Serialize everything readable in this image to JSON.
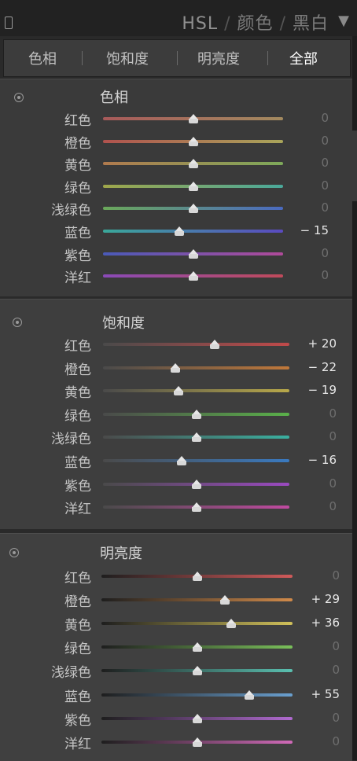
{
  "header": {
    "title_hsl": "HSL",
    "sep1": "/",
    "title_color": "颜色",
    "sep2": "/",
    "title_bw": "黑白",
    "arrow": "▼"
  },
  "tabs": [
    {
      "label": "色相"
    },
    {
      "label": "饱和度"
    },
    {
      "label": "明亮度"
    },
    {
      "label": "全部"
    }
  ],
  "active_tab": "全部",
  "sections": [
    {
      "title": "色相",
      "rows": [
        {
          "label": "红色",
          "value": "0",
          "n": 0,
          "grad": [
            "#a85a5a",
            "#a38a5f"
          ]
        },
        {
          "label": "橙色",
          "value": "0",
          "n": 0,
          "grad": [
            "#b0524e",
            "#a9a55a"
          ]
        },
        {
          "label": "黄色",
          "value": "0",
          "n": 0,
          "grad": [
            "#b07a4e",
            "#7ea95a"
          ]
        },
        {
          "label": "绿色",
          "value": "0",
          "n": 0,
          "grad": [
            "#9fa64a",
            "#4aa89a"
          ]
        },
        {
          "label": "浅绿色",
          "value": "0",
          "n": 0,
          "grad": [
            "#6aa85a",
            "#4a6ac0"
          ]
        },
        {
          "label": "蓝色",
          "value": "− 15",
          "n": -15,
          "grad": [
            "#3aa89a",
            "#5a4ac0"
          ]
        },
        {
          "label": "紫色",
          "value": "0",
          "n": 0,
          "grad": [
            "#4a5ab8",
            "#b04a9a"
          ]
        },
        {
          "label": "洋红",
          "value": "0",
          "n": 0,
          "grad": [
            "#8a4ab8",
            "#c04a5a"
          ]
        }
      ]
    },
    {
      "title": "饱和度",
      "rows": [
        {
          "label": "红色",
          "value": "+ 20",
          "n": 20,
          "grad": [
            "#4a4a4a",
            "#c04a4a"
          ]
        },
        {
          "label": "橙色",
          "value": "− 22",
          "n": -22,
          "grad": [
            "#4a4a4a",
            "#c0783a"
          ]
        },
        {
          "label": "黄色",
          "value": "− 19",
          "n": -19,
          "grad": [
            "#4a4a4a",
            "#b8a84a"
          ]
        },
        {
          "label": "绿色",
          "value": "0",
          "n": 0,
          "grad": [
            "#4a4a4a",
            "#5ab04a"
          ]
        },
        {
          "label": "浅绿色",
          "value": "0",
          "n": 0,
          "grad": [
            "#4a4a4a",
            "#3ab0a0"
          ]
        },
        {
          "label": "蓝色",
          "value": "− 16",
          "n": -16,
          "grad": [
            "#4a4a4a",
            "#3a7ac0"
          ]
        },
        {
          "label": "紫色",
          "value": "0",
          "n": 0,
          "grad": [
            "#4a4a4a",
            "#9a4ac0"
          ]
        },
        {
          "label": "洋红",
          "value": "0",
          "n": 0,
          "grad": [
            "#4a4a4a",
            "#c04aa0"
          ]
        }
      ]
    },
    {
      "title": "明亮度",
      "rows": [
        {
          "label": "红色",
          "value": "0",
          "n": 0,
          "grad": [
            "#1e1e1e",
            "#d05a5a"
          ]
        },
        {
          "label": "橙色",
          "value": "+ 29",
          "n": 29,
          "grad": [
            "#1e1e1e",
            "#d08a4a"
          ]
        },
        {
          "label": "黄色",
          "value": "+ 36",
          "n": 36,
          "grad": [
            "#1e1e1e",
            "#d0c05a"
          ]
        },
        {
          "label": "绿色",
          "value": "0",
          "n": 0,
          "grad": [
            "#1e1e1e",
            "#7ac05a"
          ]
        },
        {
          "label": "浅绿色",
          "value": "0",
          "n": 0,
          "grad": [
            "#1e1e1e",
            "#5ac0b0"
          ]
        },
        {
          "label": "蓝色",
          "value": "+ 55",
          "n": 55,
          "grad": [
            "#1e1e1e",
            "#6aa0d0"
          ]
        },
        {
          "label": "紫色",
          "value": "0",
          "n": 0,
          "grad": [
            "#1e1e1e",
            "#b06ad0"
          ]
        },
        {
          "label": "洋红",
          "value": "0",
          "n": 0,
          "grad": [
            "#1e1e1e",
            "#d06ab8"
          ]
        }
      ]
    }
  ],
  "colors": {
    "value_zero": "#6e6e6e",
    "value_nonzero": "#e8e8e8"
  }
}
